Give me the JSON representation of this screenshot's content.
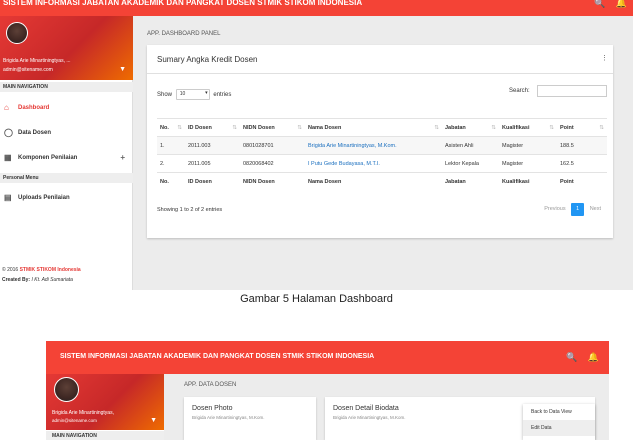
{
  "shot1": {
    "app_title": "SISTEM INFORMASI JABATAN AKADEMIK DAN PANGKAT DOSEN STMIK STIKOM INDONESIA",
    "profile": {
      "name": "Brigida Arie Minartiningtyas, ...",
      "email": "admin@sitename.com"
    },
    "nav_header": "MAIN NAVIGATION",
    "nav_items": [
      {
        "label": "Dashboard",
        "icon": "home-icon"
      },
      {
        "label": "Data Dosen",
        "icon": "user-icon"
      },
      {
        "label": "Komponen Penilaian",
        "icon": "grid-icon"
      }
    ],
    "personal_menu_header": "Personal Menu",
    "personal_items": [
      {
        "label": "Uploads Penilaian",
        "icon": "upload-icon"
      }
    ],
    "footer": {
      "copyright_prefix": "© 2016 ",
      "copyright_brand": "STMIK STIKOM Indonesia",
      "created_by_label": "Created By:",
      "created_by_name": " I Kt. Adi Sumariata"
    },
    "breadcrumb": "APP. DASHBOARD PANEL",
    "card": {
      "title": "Sumary Angka Kredit Dosen",
      "show_label": "Show",
      "entries_value": "10",
      "entries_label": "entries",
      "search_label": "Search:",
      "columns": [
        "No.",
        "ID Dosen",
        "NIDN Dosen",
        "Nama Dosen",
        "Jabatan",
        "Kualifikasi",
        "Point"
      ],
      "rows": [
        [
          "1.",
          "2011.003",
          "0801028701",
          "Brigida Arie Minartiningtyas, M.Kom.",
          "Asisten Ahli",
          "Magister",
          "188.5"
        ],
        [
          "2.",
          "2011.005",
          "0820068402",
          "I Putu Gede Budayasa, M.T.I.",
          "Lektor Kepala",
          "Magister",
          "162.5"
        ]
      ],
      "info": "Showing 1 to 2 of 2 entries",
      "pager": {
        "previous": "Previous",
        "current": "1",
        "next": "Next"
      }
    }
  },
  "caption": "Gambar 5 Halaman Dashboard",
  "shot2": {
    "app_title": "SISTEM INFORMASI JABATAN AKADEMIK DAN PANGKAT DOSEN STMIK STIKOM INDONESIA",
    "profile": {
      "name": "Brigida Arie Minartiningtyas,",
      "email": "admin@sitename.com"
    },
    "nav_header": "MAIN NAVIGATION",
    "breadcrumb": "APP. DATA DOSEN",
    "photo_card": {
      "title": "Dosen Photo",
      "subtitle": "Brigida Arie Minartiningtyas, M.Kom."
    },
    "detail_card": {
      "title": "Dosen Detail Biodata",
      "subtitle": "Brigida Arie Minartiningtyas, M.Kom."
    },
    "dropdown": [
      "Back to Data View",
      "Edit Data"
    ]
  }
}
